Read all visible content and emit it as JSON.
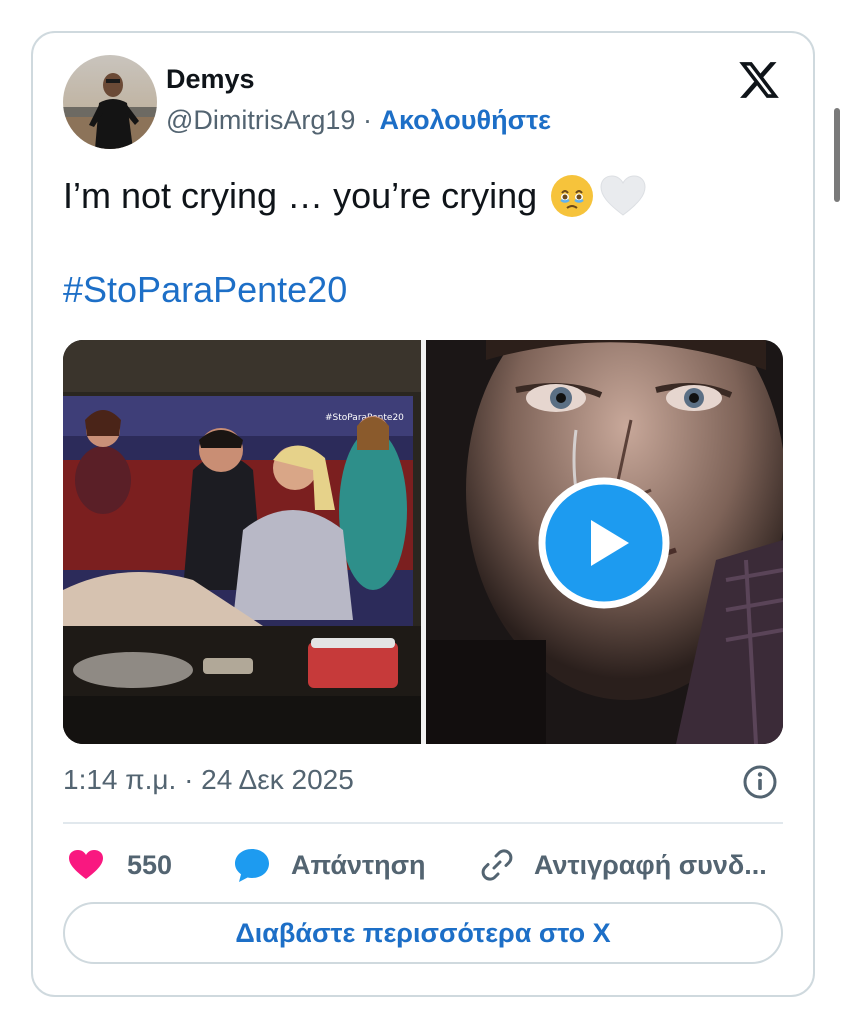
{
  "author": {
    "name": "Demys",
    "handle": "@DimitrisArg19",
    "separator": "·",
    "follow_label": "Ακολουθήστε"
  },
  "tweet": {
    "text": "I’m not crying … you’re crying",
    "hashtag": "#StoParaPente20",
    "emojis": [
      "face-holding-back-tears",
      "white-heart"
    ]
  },
  "media": {
    "left_overlay_text": "#StoParaPente20",
    "right_kind": "video"
  },
  "meta": {
    "timestamp": "1:14 π.μ. · 24 Δεκ 2025"
  },
  "actions": {
    "like_count": "550",
    "reply_label": "Απάντηση",
    "copy_label": "Αντιγραφή συνδ..."
  },
  "read_more_label": "Διαβάστε περισσότερα στο X",
  "colors": {
    "link": "#1d6fc7",
    "heart": "#f91880",
    "reply": "#1d9bf0",
    "border": "#cfd9de",
    "secondary_text": "#536471"
  }
}
